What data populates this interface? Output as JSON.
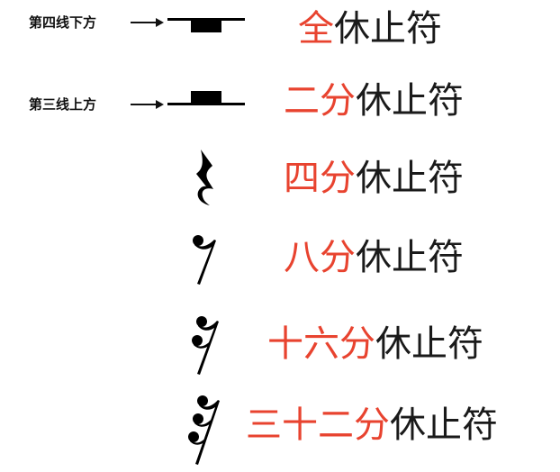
{
  "colors": {
    "accent": "#e8432f",
    "text": "#1a1a1a",
    "symbol": "#000000"
  },
  "rows": [
    {
      "position_label": "第四线下方",
      "prefix": "全",
      "suffix": "休止符",
      "symbol": "whole-rest"
    },
    {
      "position_label": "第三线上方",
      "prefix": "二分",
      "suffix": "休止符",
      "symbol": "half-rest"
    },
    {
      "prefix": "四分",
      "suffix": "休止符",
      "symbol": "quarter-rest"
    },
    {
      "prefix": "八分",
      "suffix": "休止符",
      "symbol": "eighth-rest"
    },
    {
      "prefix": "十六分",
      "suffix": "休止符",
      "symbol": "sixteenth-rest"
    },
    {
      "prefix": "三十二分",
      "suffix": "休止符",
      "symbol": "thirty-second-rest"
    }
  ]
}
